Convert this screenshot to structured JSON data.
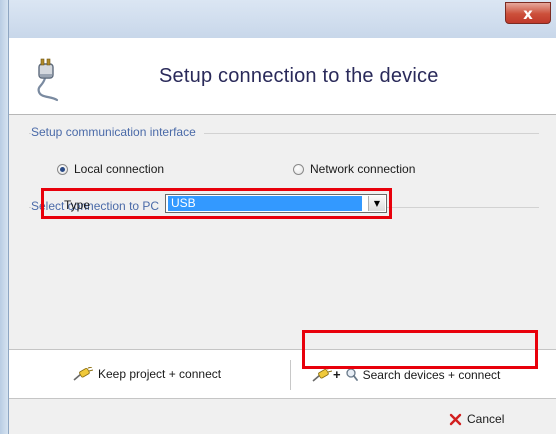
{
  "window": {
    "close_label": "x"
  },
  "dialog": {
    "title": "Setup connection to the device",
    "icon": "plug-icon"
  },
  "communication": {
    "section_label": "Setup communication interface",
    "options": [
      {
        "label": "Local connection",
        "checked": true
      },
      {
        "label": "Network connection",
        "checked": false
      }
    ]
  },
  "pc_connection": {
    "section_label": "Select connection to PC",
    "type_label": "Type",
    "type_value": "USB"
  },
  "actions": {
    "keep_label": "Keep project + connect",
    "search_label": "Search devices + connect",
    "cancel_label": "Cancel"
  },
  "colors": {
    "highlight": "#e8000b",
    "selection": "#3399ff",
    "section_text": "#4a6aa8"
  }
}
